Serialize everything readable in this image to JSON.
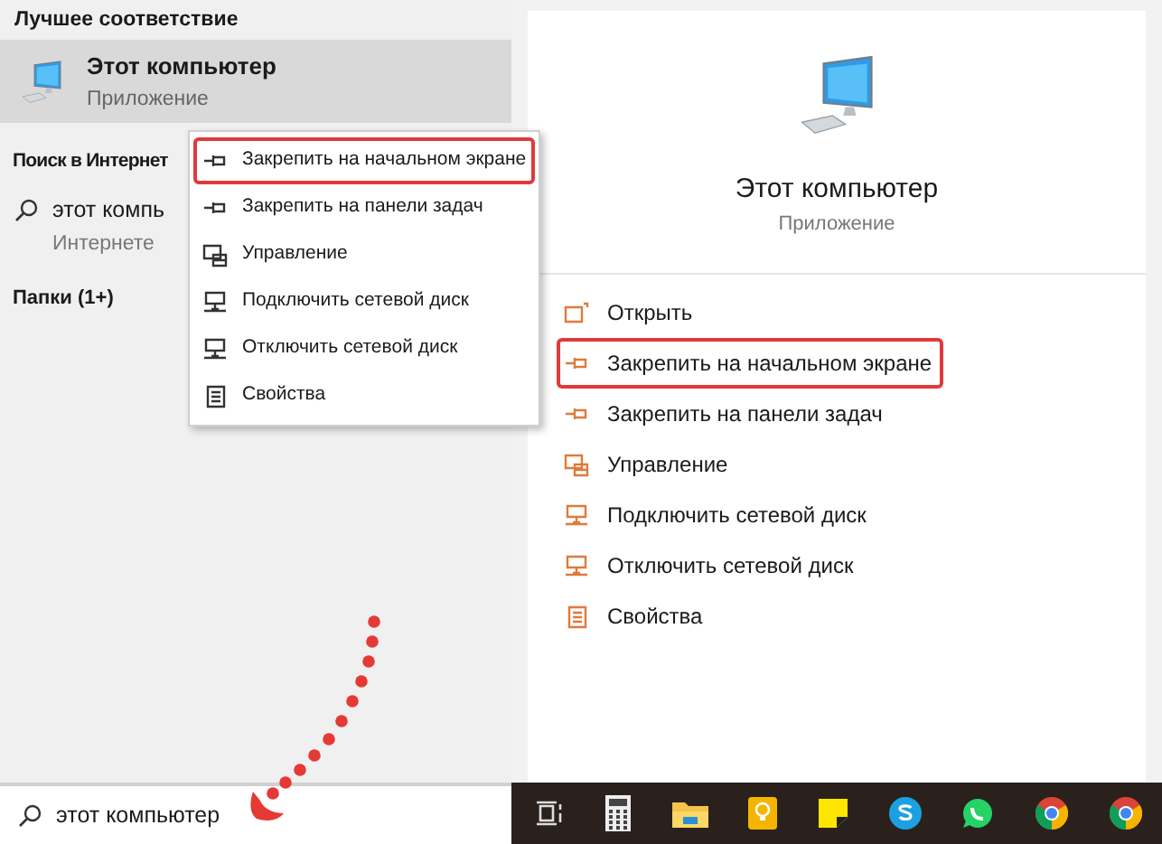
{
  "left_panel": {
    "best_match_heading": "Лучшее соответствие",
    "best_match": {
      "title": "Этот компьютер",
      "subtitle": "Приложение",
      "selected": true
    },
    "web_heading": "Поиск в Интернет",
    "web_result": {
      "title": "этот компь",
      "subtitle": "Интернете"
    },
    "folders_heading": "Папки (1+)"
  },
  "context_menu": {
    "items": [
      {
        "kind": "pin",
        "label": "Закрепить на начальном экране",
        "highlighted": true
      },
      {
        "kind": "pin",
        "label": "Закрепить на панели задач",
        "highlighted": false
      },
      {
        "kind": "manage",
        "label": "Управление",
        "highlighted": false
      },
      {
        "kind": "drive",
        "label": "Подключить сетевой диск",
        "highlighted": false
      },
      {
        "kind": "drive",
        "label": "Отключить сетевой диск",
        "highlighted": false
      },
      {
        "kind": "props",
        "label": "Свойства",
        "highlighted": false
      }
    ]
  },
  "detail_panel": {
    "title": "Этот компьютер",
    "subtitle": "Приложение",
    "actions": [
      {
        "kind": "open",
        "label": "Открыть",
        "highlighted": false
      },
      {
        "kind": "pin",
        "label": "Закрепить на начальном экране",
        "highlighted": true
      },
      {
        "kind": "pin",
        "label": "Закрепить на панели задач",
        "highlighted": false
      },
      {
        "kind": "manage",
        "label": "Управление",
        "highlighted": false
      },
      {
        "kind": "drive",
        "label": "Подключить сетевой диск",
        "highlighted": false
      },
      {
        "kind": "drive",
        "label": "Отключить сетевой диск",
        "highlighted": false
      },
      {
        "kind": "props",
        "label": "Свойства",
        "highlighted": false
      }
    ]
  },
  "search_box": {
    "value": "этот компьютер"
  },
  "taskbar": {
    "apps": [
      {
        "kind": "taskview"
      },
      {
        "kind": "calculator"
      },
      {
        "kind": "explorer"
      },
      {
        "kind": "keep"
      },
      {
        "kind": "notes"
      },
      {
        "kind": "skype"
      },
      {
        "kind": "whatsapp"
      },
      {
        "kind": "chrome"
      },
      {
        "kind": "chrome"
      }
    ]
  }
}
